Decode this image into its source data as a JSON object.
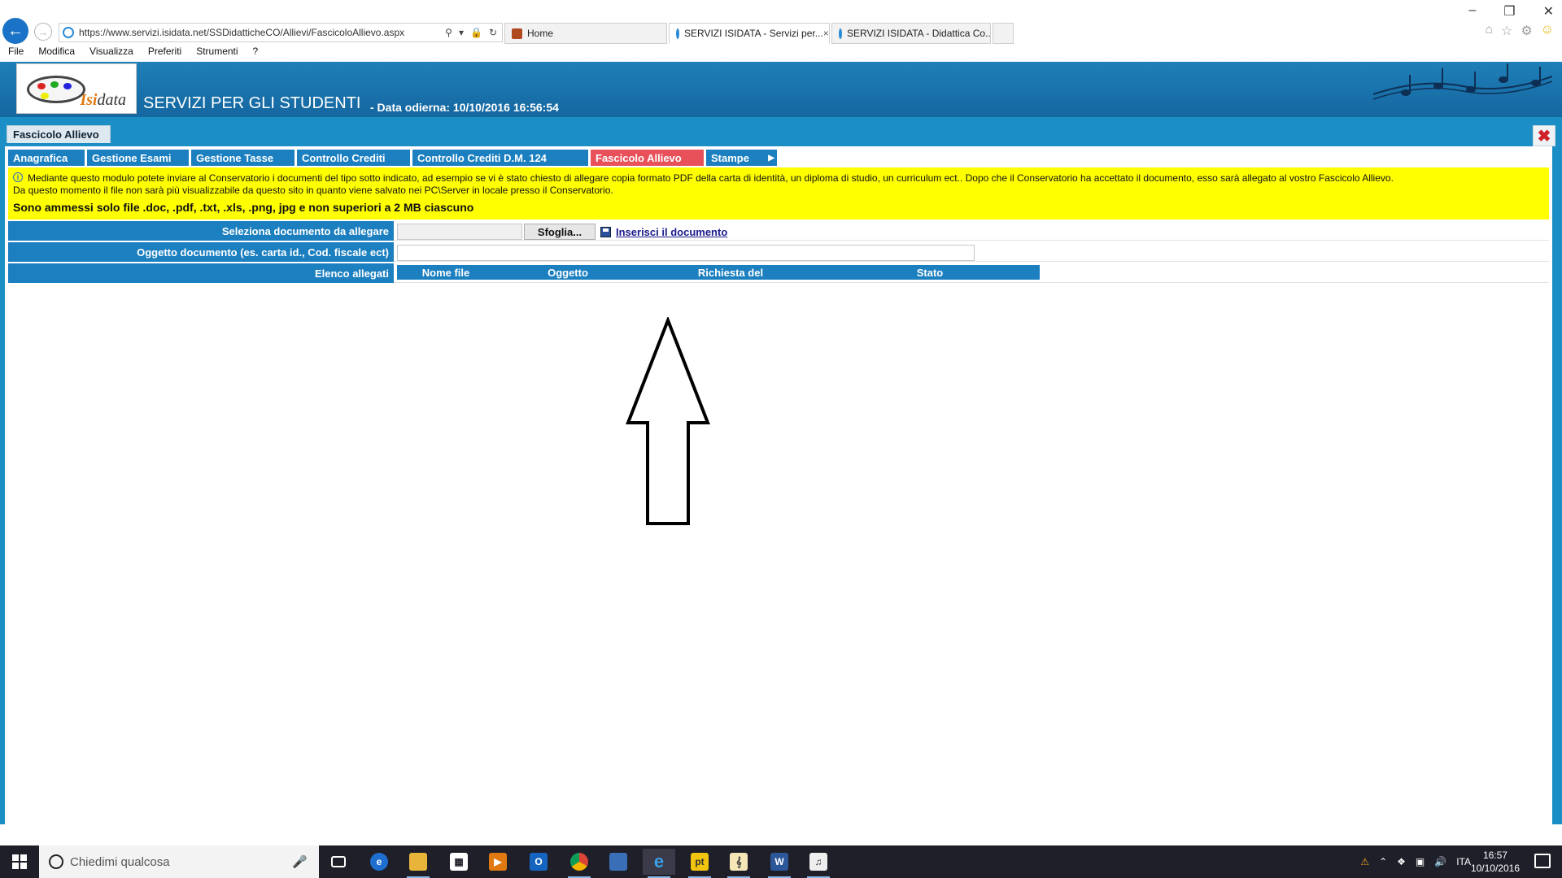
{
  "browser": {
    "url": "https://www.servizi.isidata.net/SSDidatticheCO/Allievi/FascicoloAllievo.aspx",
    "tabs": [
      {
        "title": "Home"
      },
      {
        "title": "SERVIZI ISIDATA - Servizi per...",
        "close": "×"
      },
      {
        "title": "SERVIZI ISIDATA - Didattica Co..."
      }
    ],
    "menu": [
      "File",
      "Modifica",
      "Visualizza",
      "Preferiti",
      "Strumenti",
      "?"
    ]
  },
  "header": {
    "logo_text": "data",
    "logo_prefix": "Isi",
    "title": "SERVIZI PER GLI STUDENTI",
    "date": "- Data odierna: 10/10/2016 16:56:54"
  },
  "page_tab": "Fascicolo Allievo",
  "nav": [
    {
      "label": "Anagrafica"
    },
    {
      "label": "Gestione Esami"
    },
    {
      "label": "Gestione Tasse"
    },
    {
      "label": "Controllo Crediti"
    },
    {
      "label": "Controllo Crediti D.M. 124"
    },
    {
      "label": "Fascicolo Allievo"
    },
    {
      "label": "Stampe"
    }
  ],
  "notice": {
    "line1": "Mediante questo modulo potete inviare al Conservatorio i documenti del tipo sotto indicato, ad esempio se vi è stato chiesto di allegare copia formato PDF della carta di identità, un diploma di studio, un curriculum ect.. Dopo che il Conservatorio ha accettato il documento, esso sarà allegato al vostro Fascicolo Allievo.",
    "line2": "Da questo momento il file non sarà più visualizzabile da questo sito in quanto viene salvato nei PC\\Server in locale presso il Conservatorio.",
    "rule": "Sono ammessi solo file .doc, .pdf, .txt, .xls, .png, jpg e non superiori a 2 MB ciascuno"
  },
  "form": {
    "select_label": "Seleziona documento da allegare",
    "browse_label": "Sfoglia...",
    "insert_label": "Inserisci il documento",
    "subject_label": "Oggetto documento (es. carta id., Cod. fiscale ect)",
    "list_label": "Elenco allegati",
    "columns": [
      "Nome file",
      "Oggetto",
      "Richiesta del",
      "Stato"
    ]
  },
  "taskbar": {
    "search_placeholder": "Chiedimi qualcosa",
    "lang": "ITA",
    "time": "16:57",
    "date": "10/10/2016"
  },
  "colors": {
    "accent_blue": "#1b7fc0",
    "active_tab": "#e8505a",
    "notice_bg": "#ffff00"
  }
}
